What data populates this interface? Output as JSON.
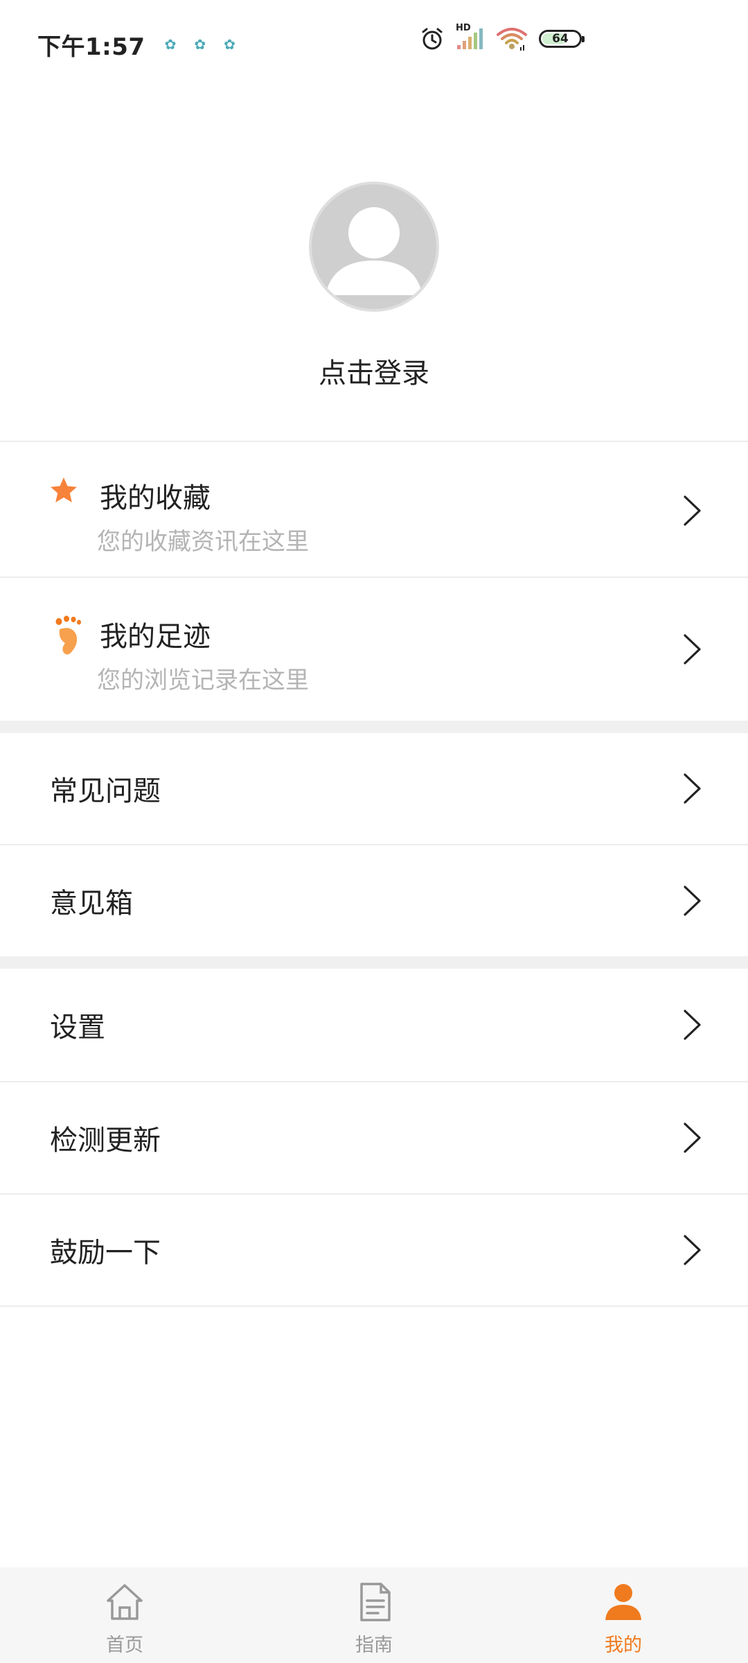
{
  "status_bar": {
    "time": "下午1:57",
    "network_label": "HD",
    "battery": "64"
  },
  "profile": {
    "login_label": "点击登录"
  },
  "menu": {
    "favorites": {
      "title": "我的收藏",
      "subtitle": "您的收藏资讯在这里"
    },
    "history": {
      "title": "我的足迹",
      "subtitle": "您的浏览记录在这里"
    },
    "faq": {
      "title": "常见问题"
    },
    "feedback": {
      "title": "意见箱"
    },
    "settings": {
      "title": "设置"
    },
    "update": {
      "title": "检测更新"
    },
    "encourage": {
      "title": "鼓励一下"
    }
  },
  "bottom_nav": {
    "home": "首页",
    "guide": "指南",
    "mine": "我的"
  },
  "colors": {
    "accent": "#f07a1e",
    "text": "#222222",
    "subtext": "#b4b4b4"
  }
}
